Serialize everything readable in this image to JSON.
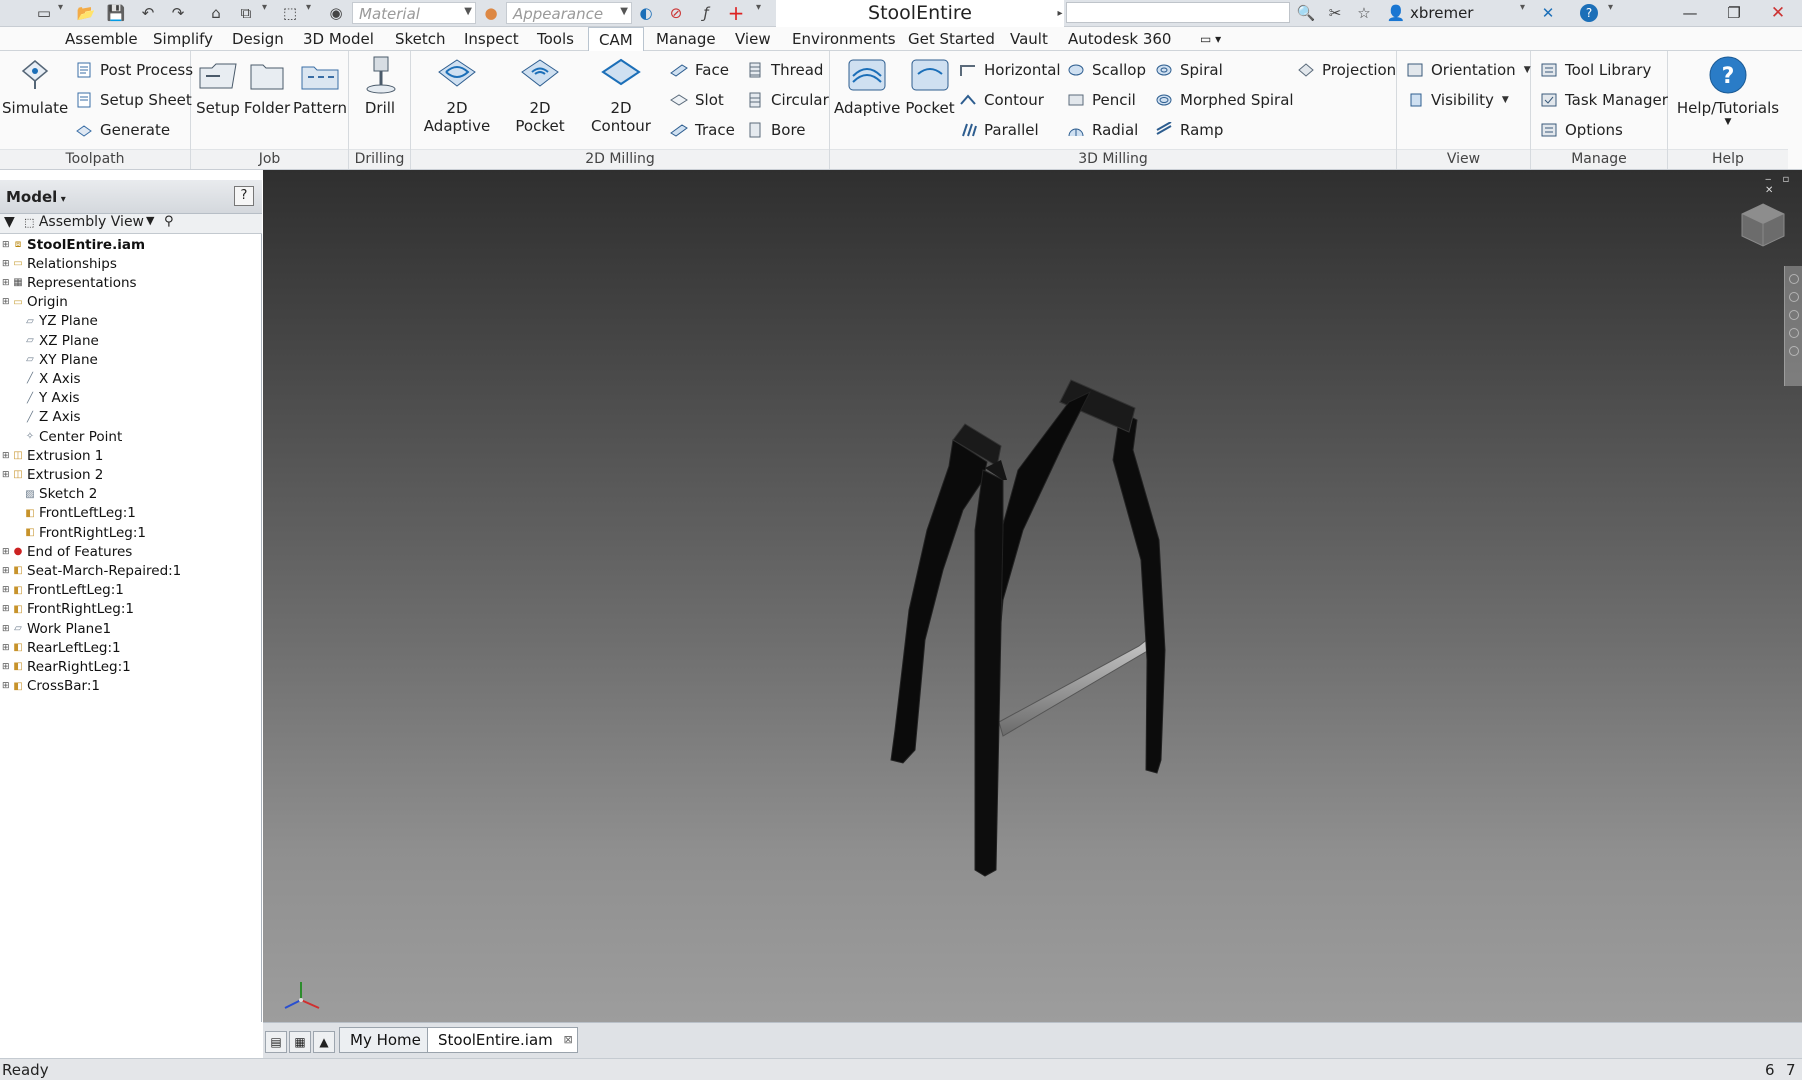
{
  "titlebar": {
    "material_placeholder": "Material",
    "appearance_placeholder": "Appearance",
    "document_title": "StoolEntire",
    "username": "xbremer",
    "help_glyph": "?"
  },
  "ribbon_tabs": [
    "Assemble",
    "Simplify",
    "Design",
    "3D Model",
    "Sketch",
    "Inspect",
    "Tools",
    "CAM",
    "Manage",
    "View",
    "Environments",
    "Get Started",
    "Vault",
    "Autodesk 360"
  ],
  "active_tab": "CAM",
  "ribbon": {
    "toolpath": {
      "label": "Toolpath",
      "simulate": "Simulate",
      "post_process": "Post Process",
      "setup_sheet": "Setup Sheet",
      "generate": "Generate"
    },
    "job": {
      "label": "Job",
      "setup": "Setup",
      "folder": "Folder",
      "pattern": "Pattern"
    },
    "drilling": {
      "label": "Drilling",
      "drill": "Drill"
    },
    "milling_2d": {
      "label": "2D Milling",
      "adaptive": "2D Adaptive",
      "pocket": "2D Pocket",
      "contour": "2D Contour",
      "face": "Face",
      "slot": "Slot",
      "trace": "Trace",
      "thread": "Thread",
      "circular": "Circular",
      "bore": "Bore"
    },
    "milling_3d": {
      "label": "3D Milling",
      "adaptive": "Adaptive",
      "pocket": "Pocket",
      "horizontal": "Horizontal",
      "contour": "Contour",
      "parallel": "Parallel",
      "scallop": "Scallop",
      "pencil": "Pencil",
      "radial": "Radial",
      "spiral": "Spiral",
      "morphed_spiral": "Morphed Spiral",
      "ramp": "Ramp",
      "projection": "Projection"
    },
    "view": {
      "label": "View",
      "orientation": "Orientation",
      "visibility": "Visibility"
    },
    "manage": {
      "label": "Manage",
      "tool_library": "Tool Library",
      "task_manager": "Task Manager",
      "options": "Options"
    },
    "help": {
      "label": "Help",
      "help_tutorials": "Help/Tutorials"
    }
  },
  "browser": {
    "title": "Model",
    "view_mode": "Assembly View",
    "help_glyph": "?",
    "tree": [
      {
        "label": "StoolEntire.iam",
        "icon": "assembly-icon",
        "level": 0,
        "bold": true
      },
      {
        "label": "Relationships",
        "icon": "folder-icon",
        "level": 0
      },
      {
        "label": "Representations",
        "icon": "representations-icon",
        "level": 0
      },
      {
        "label": "Origin",
        "icon": "folder-icon",
        "level": 0
      },
      {
        "label": "YZ Plane",
        "icon": "plane-icon",
        "level": 1
      },
      {
        "label": "XZ Plane",
        "icon": "plane-icon",
        "level": 1
      },
      {
        "label": "XY Plane",
        "icon": "plane-icon",
        "level": 1
      },
      {
        "label": "X Axis",
        "icon": "axis-icon",
        "level": 1
      },
      {
        "label": "Y Axis",
        "icon": "axis-icon",
        "level": 1
      },
      {
        "label": "Z Axis",
        "icon": "axis-icon",
        "level": 1
      },
      {
        "label": "Center Point",
        "icon": "point-icon",
        "level": 1
      },
      {
        "label": "Extrusion 1",
        "icon": "extrusion-icon",
        "level": 0
      },
      {
        "label": "Extrusion 2",
        "icon": "extrusion-icon",
        "level": 0
      },
      {
        "label": "Sketch 2",
        "icon": "sketch-icon",
        "level": 1
      },
      {
        "label": "FrontLeftLeg:1",
        "icon": "part-icon",
        "level": 1
      },
      {
        "label": "FrontRightLeg:1",
        "icon": "part-icon",
        "level": 1
      },
      {
        "label": "End of Features",
        "icon": "end-of-features-icon",
        "level": 0
      },
      {
        "label": "Seat-March-Repaired:1",
        "icon": "part-icon",
        "level": 0
      },
      {
        "label": "FrontLeftLeg:1",
        "icon": "part-icon",
        "level": 0
      },
      {
        "label": "FrontRightLeg:1",
        "icon": "part-icon",
        "level": 0
      },
      {
        "label": "Work Plane1",
        "icon": "plane-icon",
        "level": 0
      },
      {
        "label": "RearLeftLeg:1",
        "icon": "part-icon",
        "level": 0
      },
      {
        "label": "RearRightLeg:1",
        "icon": "part-icon",
        "level": 0
      },
      {
        "label": "CrossBar:1",
        "icon": "part-icon",
        "level": 0
      }
    ]
  },
  "doc_tabs": [
    {
      "label": "My Home",
      "active": false
    },
    {
      "label": "StoolEntire.iam",
      "active": true
    }
  ],
  "status": {
    "text": "Ready",
    "count1": "6",
    "count2": "7"
  },
  "colors": {
    "accent": "#1c6fb8",
    "active_tab_text": "#222222",
    "viewport_top": "#2f2f2f",
    "viewport_bottom": "#9d9d9d"
  }
}
